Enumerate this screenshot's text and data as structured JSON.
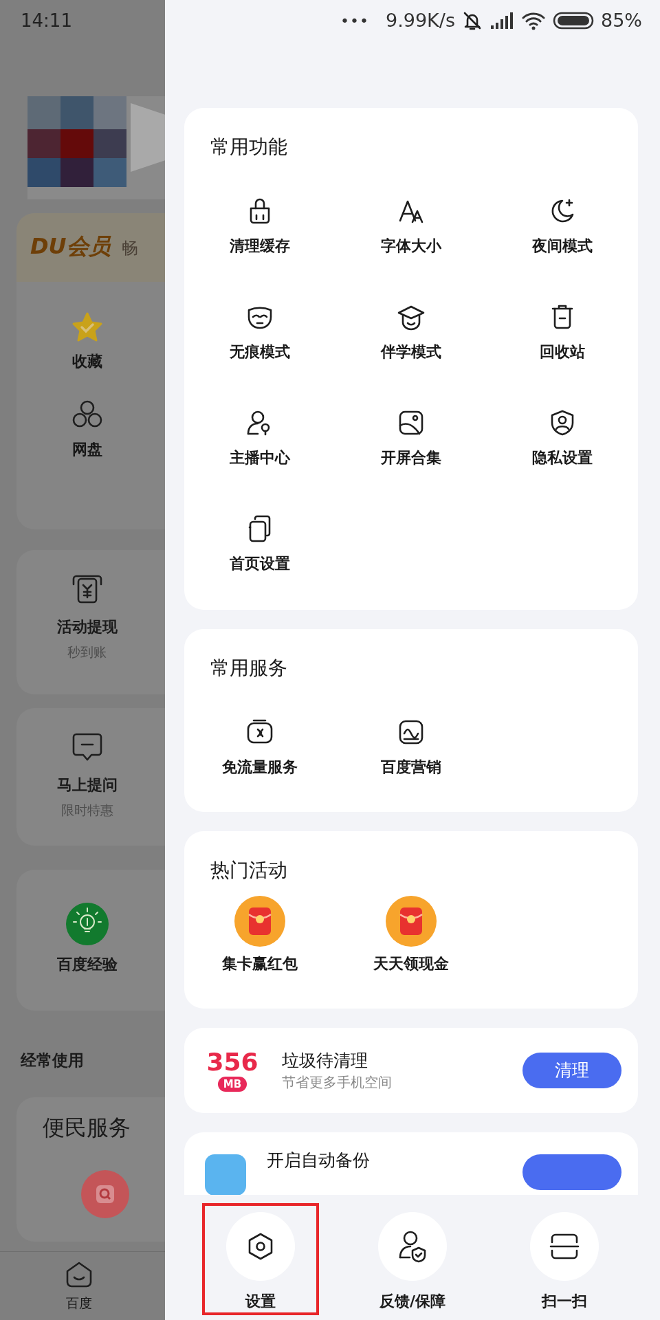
{
  "status_bar": {
    "time": "14:11",
    "more": "•••",
    "speed": "9.99K/s",
    "battery": "85%"
  },
  "left_panel": {
    "member_card": {
      "logo": "DU会员",
      "tagline": "畅",
      "items": [
        {
          "label": "收藏"
        },
        {
          "label": "网盘"
        }
      ]
    },
    "promo_cards": [
      {
        "title": "活动提现",
        "subtitle": "秒到账"
      },
      {
        "title": "马上提问",
        "subtitle": "限时特惠"
      },
      {
        "title": "百度经验"
      }
    ],
    "frequent_heading": "经常使用",
    "service_card": {
      "title": "便民服务"
    },
    "bottom_nav": [
      {
        "label": "百度"
      }
    ]
  },
  "sections": [
    {
      "title": "常用功能",
      "items": [
        {
          "label": "清理缓存"
        },
        {
          "label": "字体大小"
        },
        {
          "label": "夜间模式"
        },
        {
          "label": "无痕模式"
        },
        {
          "label": "伴学模式"
        },
        {
          "label": "回收站"
        },
        {
          "label": "主播中心"
        },
        {
          "label": "开屏合集"
        },
        {
          "label": "隐私设置"
        },
        {
          "label": "首页设置"
        }
      ]
    },
    {
      "title": "常用服务",
      "items": [
        {
          "label": "免流量服务"
        },
        {
          "label": "百度营销"
        }
      ]
    },
    {
      "title": "热门活动",
      "items": [
        {
          "label": "集卡赢红包"
        },
        {
          "label": "天天领现金"
        }
      ]
    }
  ],
  "cleanup": {
    "amount": "356",
    "unit": "MB",
    "title": "垃圾待清理",
    "subtitle": "节省更多手机空间",
    "button": "清理"
  },
  "backup": {
    "title": "开启自动备份"
  },
  "bottom_actions": [
    {
      "label": "设置",
      "selected": true
    },
    {
      "label": "反馈/保障",
      "selected": false
    },
    {
      "label": "扫一扫",
      "selected": false
    }
  ]
}
